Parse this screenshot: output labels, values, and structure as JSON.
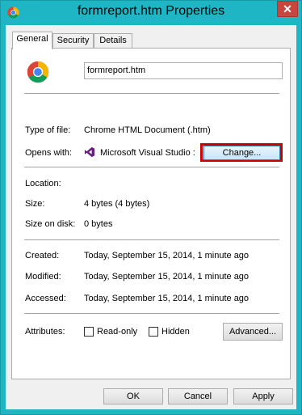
{
  "window": {
    "title": "formreport.htm Properties",
    "close_glyph": "✕"
  },
  "tabs": [
    {
      "label": "General",
      "active": true
    },
    {
      "label": "Security",
      "active": false
    },
    {
      "label": "Details",
      "active": false
    }
  ],
  "general": {
    "file_name": "formreport.htm",
    "type_of_file_label": "Type of file:",
    "type_of_file": "Chrome HTML Document (.htm)",
    "opens_with_label": "Opens with:",
    "opens_with": "Microsoft Visual Studio :",
    "change_button": "Change...",
    "location_label": "Location:",
    "location": "",
    "size_label": "Size:",
    "size": "4 bytes (4 bytes)",
    "size_on_disk_label": "Size on disk:",
    "size_on_disk": "0 bytes",
    "created_label": "Created:",
    "created": "Today, September 15, 2014, 1 minute ago",
    "modified_label": "Modified:",
    "modified": "Today, September 15, 2014, 1 minute ago",
    "accessed_label": "Accessed:",
    "accessed": "Today, September 15, 2014, 1 minute ago",
    "attributes_label": "Attributes:",
    "readonly_label": "Read-only",
    "readonly_checked": false,
    "hidden_label": "Hidden",
    "hidden_checked": false,
    "advanced_button": "Advanced..."
  },
  "footer": {
    "ok": "OK",
    "cancel": "Cancel",
    "apply": "Apply"
  },
  "icons": {
    "title": "chrome-icon",
    "file": "chrome-icon",
    "app": "visual-studio-icon"
  },
  "colors": {
    "titlebar": "#1eb6c5",
    "close": "#c7463f",
    "highlight": "#cc0000"
  }
}
